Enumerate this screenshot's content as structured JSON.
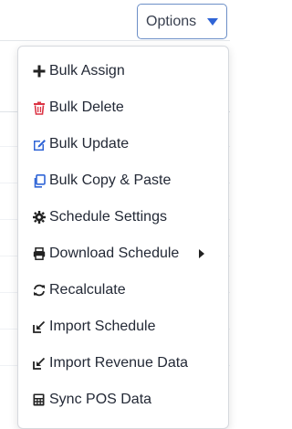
{
  "options_button": {
    "label": "Options"
  },
  "menu": {
    "items": [
      {
        "label": "Bulk Assign",
        "icon": "plus-icon"
      },
      {
        "label": "Bulk Delete",
        "icon": "trash-icon"
      },
      {
        "label": "Bulk Update",
        "icon": "edit-icon"
      },
      {
        "label": "Bulk Copy & Paste",
        "icon": "copy-icon"
      },
      {
        "label": "Schedule Settings",
        "icon": "gear-icon"
      },
      {
        "label": "Download Schedule",
        "icon": "print-icon",
        "has_submenu": true
      },
      {
        "label": "Recalculate",
        "icon": "refresh-icon"
      },
      {
        "label": "Import Schedule",
        "icon": "import-icon"
      },
      {
        "label": "Import Revenue Data",
        "icon": "import-icon",
        "highlighted": true
      },
      {
        "label": "Sync POS Data",
        "icon": "calculator-icon"
      }
    ]
  },
  "colors": {
    "accent": "#2f64d6",
    "delete_icon": "#dc3545",
    "edit_icon": "#2f64d6",
    "highlight": "#fbf320"
  }
}
